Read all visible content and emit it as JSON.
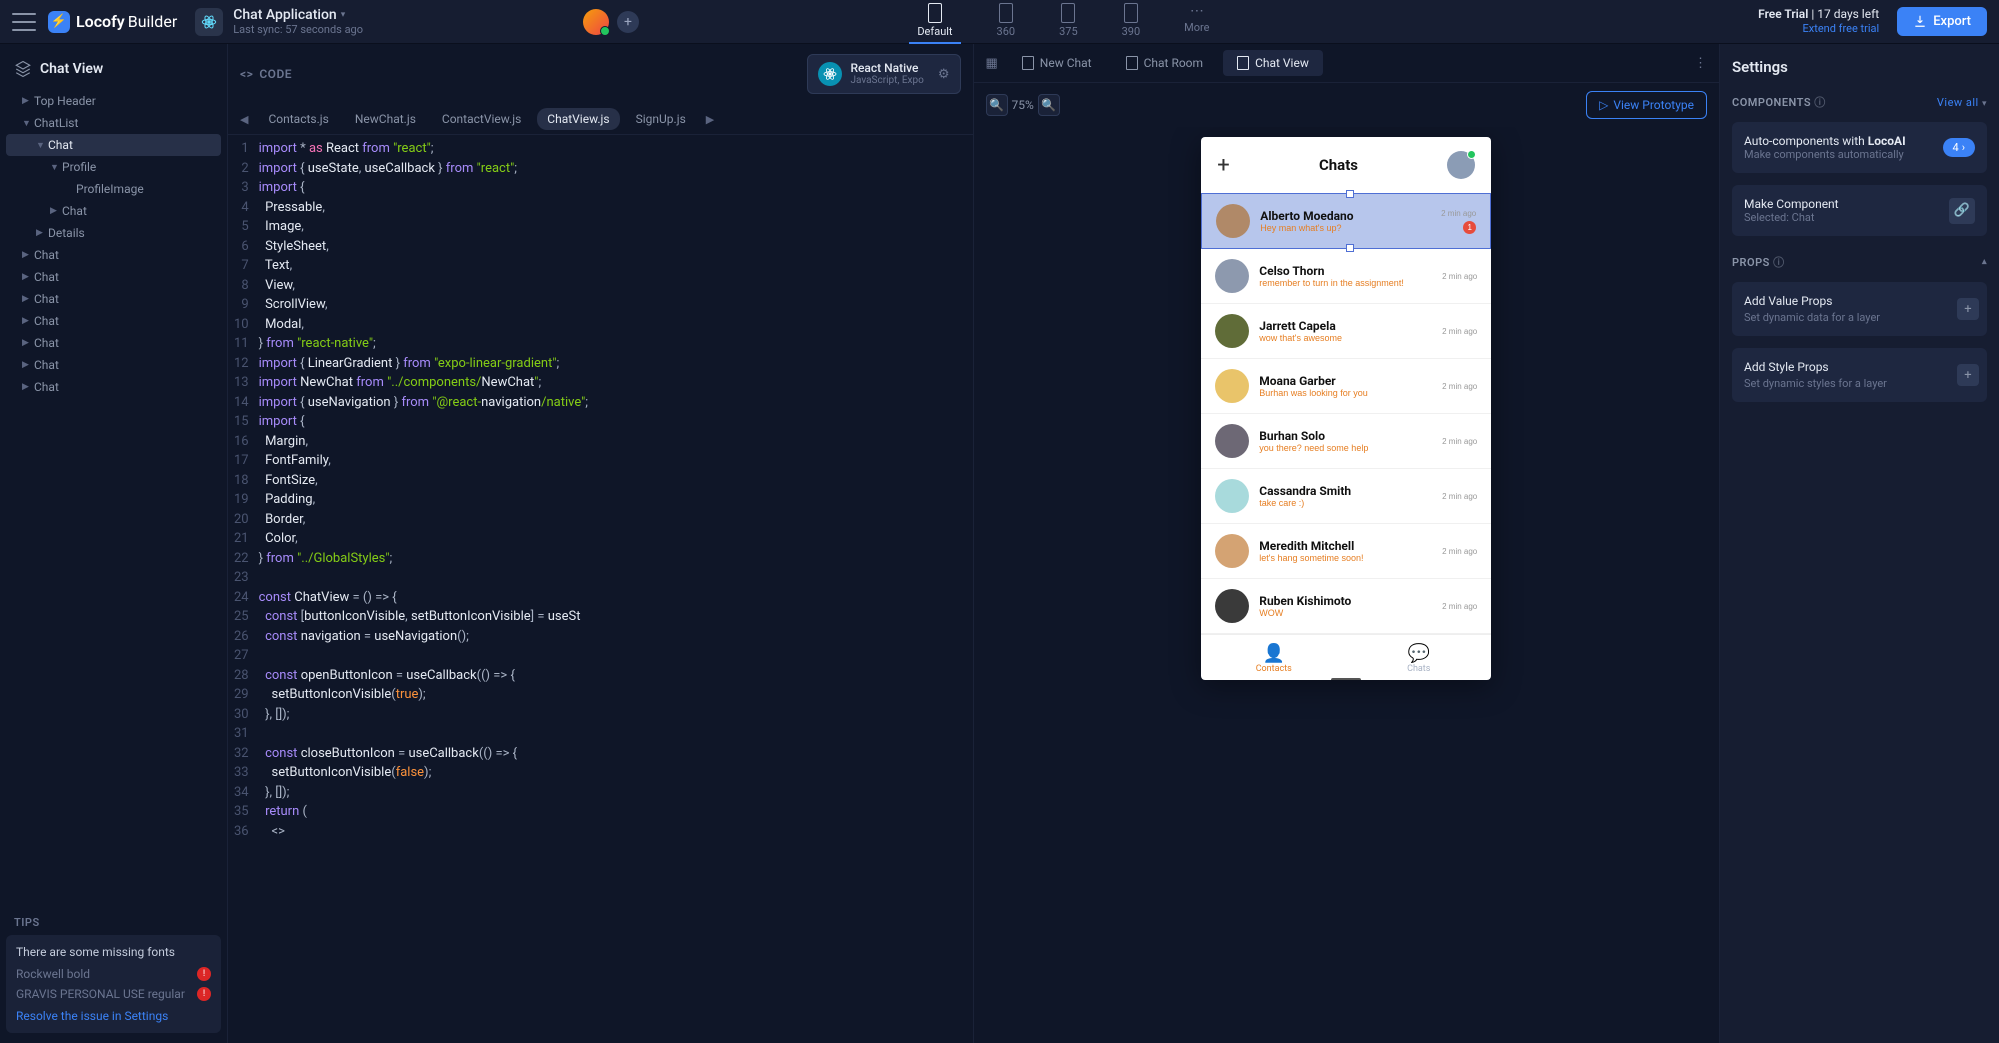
{
  "logo": {
    "brand": "Locofy",
    "suffix": "Builder"
  },
  "project": {
    "name": "Chat Application",
    "sync": "Last sync: 57 seconds ago"
  },
  "devices": [
    {
      "label": "Default",
      "active": true
    },
    {
      "label": "360"
    },
    {
      "label": "375"
    },
    {
      "label": "390"
    },
    {
      "label": "More",
      "more": true
    }
  ],
  "trial": {
    "status": "Free Trial",
    "sep": "|",
    "days": "17 days left",
    "link": "Extend free trial"
  },
  "export_label": "Export",
  "sidebar": {
    "title": "Chat View",
    "tree": [
      {
        "label": "Top Header",
        "depth": 1,
        "arrow": "right"
      },
      {
        "label": "ChatList",
        "depth": 1,
        "arrow": "down"
      },
      {
        "label": "Chat",
        "depth": 2,
        "arrow": "down",
        "sel": true
      },
      {
        "label": "Profile",
        "depth": 3,
        "arrow": "down"
      },
      {
        "label": "ProfileImage",
        "depth": 4,
        "arrow": ""
      },
      {
        "label": "Chat",
        "depth": 3,
        "arrow": "right"
      },
      {
        "label": "Details",
        "depth": 2,
        "arrow": "right"
      },
      {
        "label": "Chat",
        "depth": 1,
        "arrow": "right"
      },
      {
        "label": "Chat",
        "depth": 1,
        "arrow": "right"
      },
      {
        "label": "Chat",
        "depth": 1,
        "arrow": "right"
      },
      {
        "label": "Chat",
        "depth": 1,
        "arrow": "right"
      },
      {
        "label": "Chat",
        "depth": 1,
        "arrow": "right"
      },
      {
        "label": "Chat",
        "depth": 1,
        "arrow": "right"
      },
      {
        "label": "Chat",
        "depth": 1,
        "arrow": "right"
      }
    ],
    "tips_label": "TIPS",
    "tips": {
      "title": "There are some missing fonts",
      "fonts": [
        "Rockwell bold",
        "GRAVIS PERSONAL USE regular"
      ],
      "link": "Resolve the issue in Settings"
    }
  },
  "code": {
    "header": "CODE",
    "framework": {
      "name": "React Native",
      "sub": "JavaScript, Expo"
    },
    "tabs": [
      "Contacts.js",
      "NewChat.js",
      "ContactView.js",
      "ChatView.js",
      "SignUp.js"
    ],
    "active_tab": 3,
    "lines": [
      "import * as React from \"react\";",
      "import { useState, useCallback } from \"react\";",
      "import {",
      "  Pressable,",
      "  Image,",
      "  StyleSheet,",
      "  Text,",
      "  View,",
      "  ScrollView,",
      "  Modal,",
      "} from \"react-native\";",
      "import { LinearGradient } from \"expo-linear-gradient\";",
      "import NewChat from \"../components/NewChat\";",
      "import { useNavigation } from \"@react-navigation/native\";",
      "import {",
      "  Margin,",
      "  FontFamily,",
      "  FontSize,",
      "  Padding,",
      "  Border,",
      "  Color,",
      "} from \"../GlobalStyles\";",
      "",
      "const ChatView = () => {",
      "  const [buttonIconVisible, setButtonIconVisible] = useSt",
      "  const navigation = useNavigation();",
      "",
      "  const openButtonIcon = useCallback(() => {",
      "    setButtonIconVisible(true);",
      "  }, []);",
      "",
      "  const closeButtonIcon = useCallback(() => {",
      "    setButtonIconVisible(false);",
      "  }, []);",
      "  return (",
      "    <>"
    ]
  },
  "preview": {
    "tabs": [
      {
        "label": "New Chat"
      },
      {
        "label": "Chat Room"
      },
      {
        "label": "Chat View",
        "active": true
      }
    ],
    "zoom": "75%",
    "proto_label": "View Prototype",
    "phone": {
      "title": "Chats",
      "chats": [
        {
          "name": "Alberto Moedano",
          "msg": "Hey man what's up?",
          "time": "2 min ago",
          "badge": "1",
          "selected": true
        },
        {
          "name": "Celso Thorn",
          "msg": "remember to turn in the assignment!",
          "time": "2 min ago"
        },
        {
          "name": "Jarrett Capela",
          "msg": "wow that's awesome",
          "time": "2 min ago"
        },
        {
          "name": "Moana Garber",
          "msg": "Burhan was looking for you",
          "time": "2 min ago"
        },
        {
          "name": "Burhan Solo",
          "msg": "you there? need some help",
          "time": "2 min ago"
        },
        {
          "name": "Cassandra Smith",
          "msg": "take care :)",
          "time": "2 min ago"
        },
        {
          "name": "Meredith Mitchell",
          "msg": "let's hang sometime soon!",
          "time": "2 min ago"
        },
        {
          "name": "Ruben Kishimoto",
          "msg": "WOW",
          "time": "2 min ago"
        }
      ],
      "tabbar": [
        {
          "label": "Contacts",
          "icon": "👤",
          "active": true
        },
        {
          "label": "Chats",
          "icon": "💬"
        }
      ]
    }
  },
  "settings": {
    "title": "Settings",
    "components_header": "COMPONENTS",
    "view_all": "View all",
    "autocomp": {
      "title_pre": "Auto-components with ",
      "title_b": "LocoAI",
      "sub": "Make components automatically",
      "count": "4"
    },
    "makecomp": {
      "title": "Make Component",
      "sub": "Selected: Chat"
    },
    "props_header": "PROPS",
    "value_props": {
      "title": "Add Value Props",
      "sub": "Set dynamic data for a layer"
    },
    "style_props": {
      "title": "Add Style Props",
      "sub": "Set dynamic styles for a layer"
    }
  }
}
